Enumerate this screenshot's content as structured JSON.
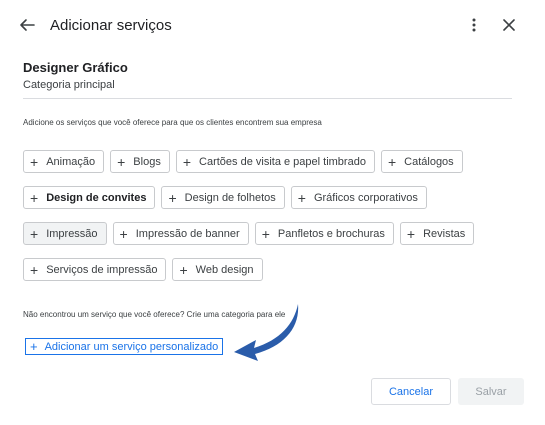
{
  "header": {
    "title": "Adicionar serviços",
    "back_icon": "arrow-left-icon",
    "more_icon": "more-vertical-icon",
    "close_icon": "close-icon"
  },
  "category": {
    "name": "Designer Gráfico",
    "subtitle": "Categoria principal"
  },
  "description": "Adicione os serviços que você oferece para que os clientes encontrem sua empresa",
  "chips": [
    [
      "Animação",
      "Blogs",
      "Cartões de visita e papel timbrado",
      "Catálogos"
    ],
    [
      "Design de convites",
      "Design de folhetos",
      "Gráficos corporativos"
    ],
    [
      "Impressão",
      "Impressão de banner",
      "Panfletos e brochuras",
      "Revistas"
    ],
    [
      "Serviços de impressão",
      "Web design"
    ]
  ],
  "chip_plus": "+",
  "not_found": "Não encontrou um serviço que você oferece? Crie uma categoria para ele",
  "custom_link": {
    "label": "Adicionar um serviço personalizado"
  },
  "buttons": {
    "cancel": "Cancelar",
    "save": "Salvar"
  },
  "colors": {
    "accent": "#1a73e8",
    "arrow": "#2a5caa",
    "disabled_bg": "#f1f3f4",
    "disabled_text": "#9aa0a6"
  }
}
